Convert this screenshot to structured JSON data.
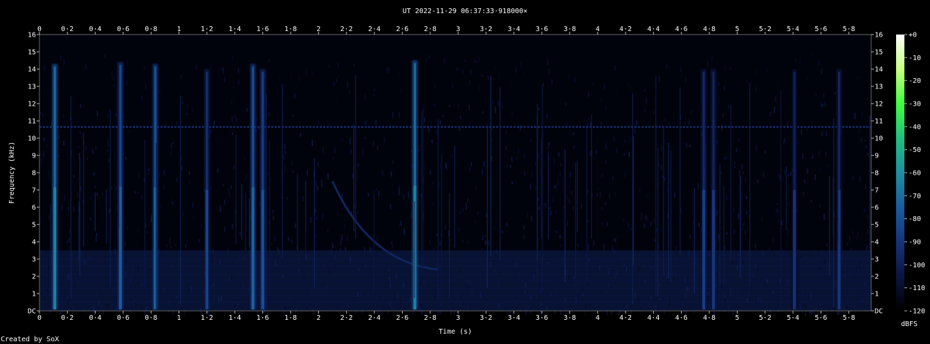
{
  "chart_data": {
    "type": "heatmap",
    "title": "UT 2022-11-29 06:37:33·918000×",
    "xlabel": "Time (s)",
    "ylabel": "Frequency (kHz)",
    "xlim": [
      0,
      5.96
    ],
    "ylim": [
      0,
      16
    ],
    "x_ticks": [
      "0",
      "0·2",
      "0·4",
      "0·6",
      "0·8",
      "1",
      "1·2",
      "1·4",
      "1·6",
      "1·8",
      "2",
      "2·2",
      "2·4",
      "2·6",
      "2·8",
      "3",
      "3·2",
      "3·4",
      "3·6",
      "3·8",
      "4",
      "4·2",
      "4·4",
      "4·6",
      "4·8",
      "5",
      "5·2",
      "5·4",
      "5·6",
      "5·8"
    ],
    "y_ticks": [
      "DC",
      "1",
      "2",
      "3",
      "4",
      "5",
      "6",
      "7",
      "8",
      "9",
      "10",
      "11",
      "12",
      "13",
      "14",
      "15",
      "16"
    ],
    "colorbar": {
      "label": "dBFS",
      "ticks": [
        "+0",
        "-10",
        "-20",
        "-30",
        "-40",
        "-50",
        "-60",
        "-70",
        "-80",
        "-90",
        "-100",
        "-110",
        "-120"
      ],
      "range": [
        -120,
        0
      ],
      "colors": [
        "#000000",
        "#0c1440",
        "#16347c",
        "#1a5ca0",
        "#1f8fa0",
        "#20c080",
        "#40ff40",
        "#c8ff80",
        "#ffffff"
      ]
    },
    "features": {
      "background_dbfs": -112,
      "horizontal_line": {
        "freq_khz": 10.65,
        "dbfs": -92
      },
      "low_freq_band": {
        "max_freq_khz": 3.5,
        "dbfs": -100
      },
      "vertical_events": [
        {
          "time_s": 0.11,
          "max_freq_khz": 14.3,
          "peak_dbfs": -62
        },
        {
          "time_s": 0.58,
          "max_freq_khz": 14.4,
          "peak_dbfs": -74
        },
        {
          "time_s": 0.83,
          "max_freq_khz": 14.3,
          "peak_dbfs": -70
        },
        {
          "time_s": 1.2,
          "max_freq_khz": 14.0,
          "peak_dbfs": -84
        },
        {
          "time_s": 1.53,
          "max_freq_khz": 14.3,
          "peak_dbfs": -72
        },
        {
          "time_s": 1.6,
          "max_freq_khz": 14.0,
          "peak_dbfs": -78
        },
        {
          "time_s": 2.69,
          "max_freq_khz": 14.5,
          "peak_dbfs": -62
        },
        {
          "time_s": 4.76,
          "max_freq_khz": 14.0,
          "peak_dbfs": -86
        },
        {
          "time_s": 4.83,
          "max_freq_khz": 14.0,
          "peak_dbfs": -88
        },
        {
          "time_s": 5.41,
          "max_freq_khz": 14.0,
          "peak_dbfs": -90
        },
        {
          "time_s": 5.73,
          "max_freq_khz": 14.0,
          "peak_dbfs": -88
        }
      ],
      "descending_chirp": {
        "start_time_s": 2.1,
        "start_freq_khz": 7.5,
        "end_time_s": 2.85,
        "end_freq_khz": 2.4,
        "dbfs": -96
      }
    }
  },
  "footer_text": "Created by SoX"
}
